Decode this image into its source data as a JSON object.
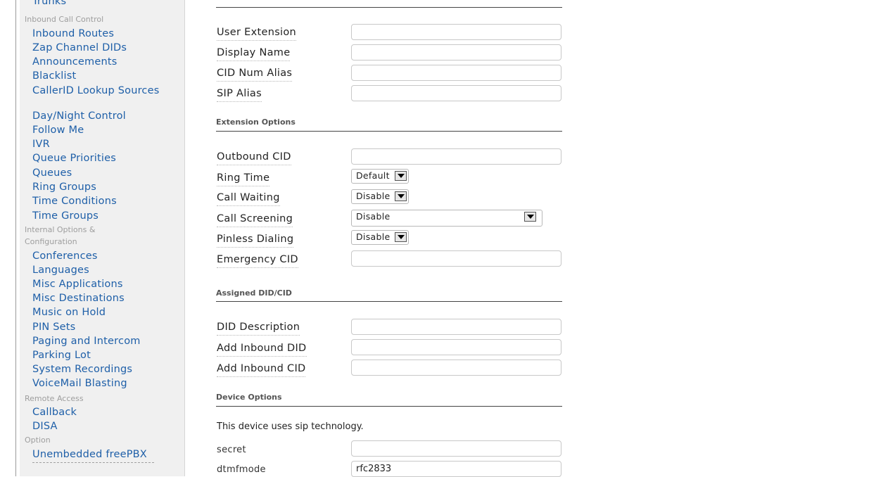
{
  "sidebar": {
    "items": [
      {
        "type": "link",
        "label": "Trunks"
      },
      {
        "type": "category",
        "label": "Inbound Call Control"
      },
      {
        "type": "link",
        "label": "Inbound Routes"
      },
      {
        "type": "link",
        "label": "Zap Channel DIDs"
      },
      {
        "type": "link",
        "label": "Announcements"
      },
      {
        "type": "link",
        "label": "Blacklist"
      },
      {
        "type": "link",
        "label": "CallerID Lookup Sources"
      },
      {
        "type": "link",
        "label": "Day/Night Control"
      },
      {
        "type": "link",
        "label": "Follow Me"
      },
      {
        "type": "link",
        "label": "IVR"
      },
      {
        "type": "link",
        "label": "Queue Priorities"
      },
      {
        "type": "link",
        "label": "Queues"
      },
      {
        "type": "link",
        "label": "Ring Groups"
      },
      {
        "type": "link",
        "label": "Time Conditions"
      },
      {
        "type": "link",
        "label": "Time Groups"
      },
      {
        "type": "category",
        "label": "Internal Options & Configuration"
      },
      {
        "type": "link",
        "label": "Conferences"
      },
      {
        "type": "link",
        "label": "Languages"
      },
      {
        "type": "link",
        "label": "Misc Applications"
      },
      {
        "type": "link",
        "label": "Misc Destinations"
      },
      {
        "type": "link",
        "label": "Music on Hold"
      },
      {
        "type": "link",
        "label": "PIN Sets"
      },
      {
        "type": "link",
        "label": "Paging and Intercom"
      },
      {
        "type": "link",
        "label": "Parking Lot"
      },
      {
        "type": "link",
        "label": "System Recordings"
      },
      {
        "type": "link",
        "label": "VoiceMail Blasting"
      },
      {
        "type": "category",
        "label": "Remote Access"
      },
      {
        "type": "link",
        "label": "Callback"
      },
      {
        "type": "link",
        "label": "DISA"
      },
      {
        "type": "category",
        "label": "Option"
      },
      {
        "type": "link",
        "label": "Unembedded freePBX"
      }
    ]
  },
  "form": {
    "fields": {
      "user_extension": {
        "label": "User Extension",
        "value": ""
      },
      "display_name": {
        "label": "Display Name",
        "value": ""
      },
      "cid_num_alias": {
        "label": "CID Num Alias",
        "value": ""
      },
      "sip_alias": {
        "label": "SIP Alias",
        "value": ""
      },
      "outbound_cid": {
        "label": "Outbound CID",
        "value": ""
      },
      "ring_time": {
        "label": "Ring Time",
        "value": "Default"
      },
      "call_waiting": {
        "label": "Call Waiting",
        "value": "Disable"
      },
      "call_screening": {
        "label": "Call Screening",
        "value": "Disable"
      },
      "pinless_dialing": {
        "label": "Pinless Dialing",
        "value": "Disable"
      },
      "emergency_cid": {
        "label": "Emergency CID",
        "value": ""
      },
      "did_description": {
        "label": "DID Description",
        "value": ""
      },
      "add_inbound_did": {
        "label": "Add Inbound DID",
        "value": ""
      },
      "add_inbound_cid": {
        "label": "Add Inbound CID",
        "value": ""
      },
      "secret": {
        "label": "secret",
        "value": ""
      },
      "dtmfmode": {
        "label": "dtmfmode",
        "value": "rfc2833"
      }
    },
    "sections": {
      "extension_options": "Extension Options",
      "assigned_did_cid": "Assigned DID/CID",
      "device_options": "Device Options"
    },
    "device_note": "This device uses sip technology."
  }
}
